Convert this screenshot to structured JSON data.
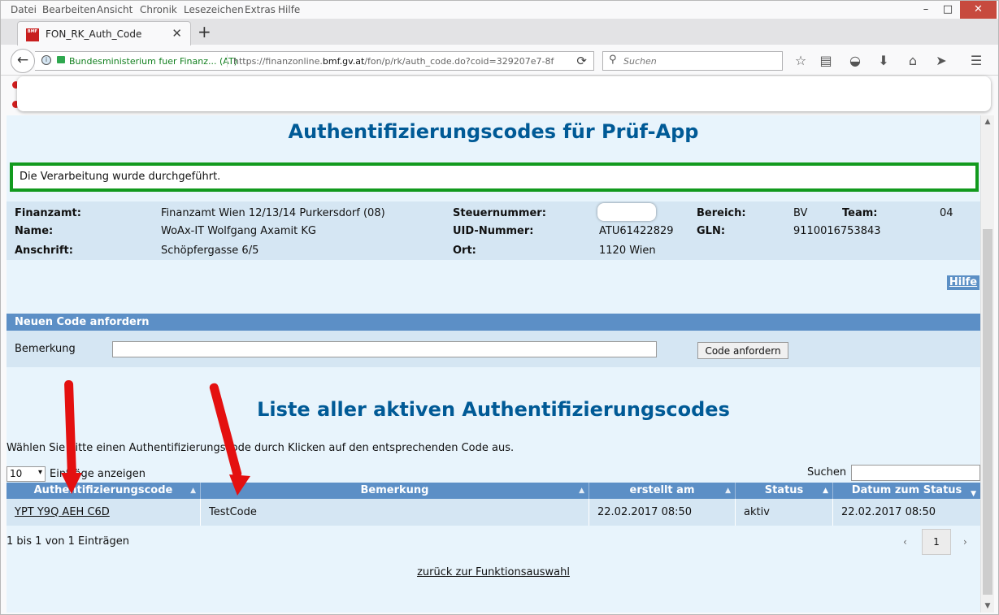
{
  "menubar": [
    "Datei",
    "Bearbeiten",
    "Ansicht",
    "Chronik",
    "Lesezeichen",
    "Extras",
    "Hilfe"
  ],
  "window_controls": {
    "minimize": "–",
    "maximize": "□",
    "close": "✕"
  },
  "tab": {
    "favicon": "BMF",
    "title": "FON_RK_Auth_Code",
    "close": "✕",
    "new": "+"
  },
  "navbar": {
    "back": "←",
    "org": "Bundesministerium fuer Finanz...  (AT)",
    "url_prefix": "https://finanzonline.",
    "url_domain": "bmf.gv.at",
    "url_suffix": "/fon/p/rk/auth_code.do?coid=329207e7-8f",
    "search_placeholder": "Suchen"
  },
  "page": {
    "title": "Authentifizierungscodes für Prüf-App",
    "message": "Die Verarbeitung wurde durchgeführt.",
    "info": {
      "finanzamt_label": "Finanzamt:",
      "finanzamt": "Finanzamt Wien 12/13/14 Purkersdorf (08)",
      "name_label": "Name:",
      "name": "WoAx-IT Wolfgang Axamit KG",
      "anschrift_label": "Anschrift:",
      "anschrift": "Schöpfergasse 6/5",
      "steuernummer_label": "Steuernummer:",
      "uid_label": "UID-Nummer:",
      "uid": "ATU61422829",
      "ort_label": "Ort:",
      "ort": "1120 Wien",
      "bereich_label": "Bereich:",
      "bereich": "BV",
      "team_label": "Team:",
      "team": "04",
      "gln_label": "GLN:",
      "gln": "9110016753843"
    },
    "hilfe": "Hilfe",
    "section": "Neuen Code anfordern",
    "bemerkung_label": "Bemerkung",
    "button": "Code anfordern",
    "list_title": "Liste aller aktiven Authentifizierungscodes",
    "instruction": "Wählen Sie bitte einen Authentifizierungscode durch Klicken auf den entsprechenden Code aus.",
    "length_value": "10",
    "length_text": "Einträge anzeigen",
    "search_label": "Suchen",
    "columns": [
      "Authentifizierungscode",
      "Bemerkung",
      "erstellt am",
      "Status",
      "Datum zum Status"
    ],
    "rows": [
      [
        "YPT Y9Q AEH C6D",
        "TestCode",
        "22.02.2017 08:50",
        "aktiv",
        "22.02.2017 08:50"
      ]
    ],
    "table_info": "1 bis 1 von 1 Einträgen",
    "page_number": "1",
    "prev": "‹",
    "next": "›",
    "back_link": "zurück zur Funktionsauswahl"
  }
}
